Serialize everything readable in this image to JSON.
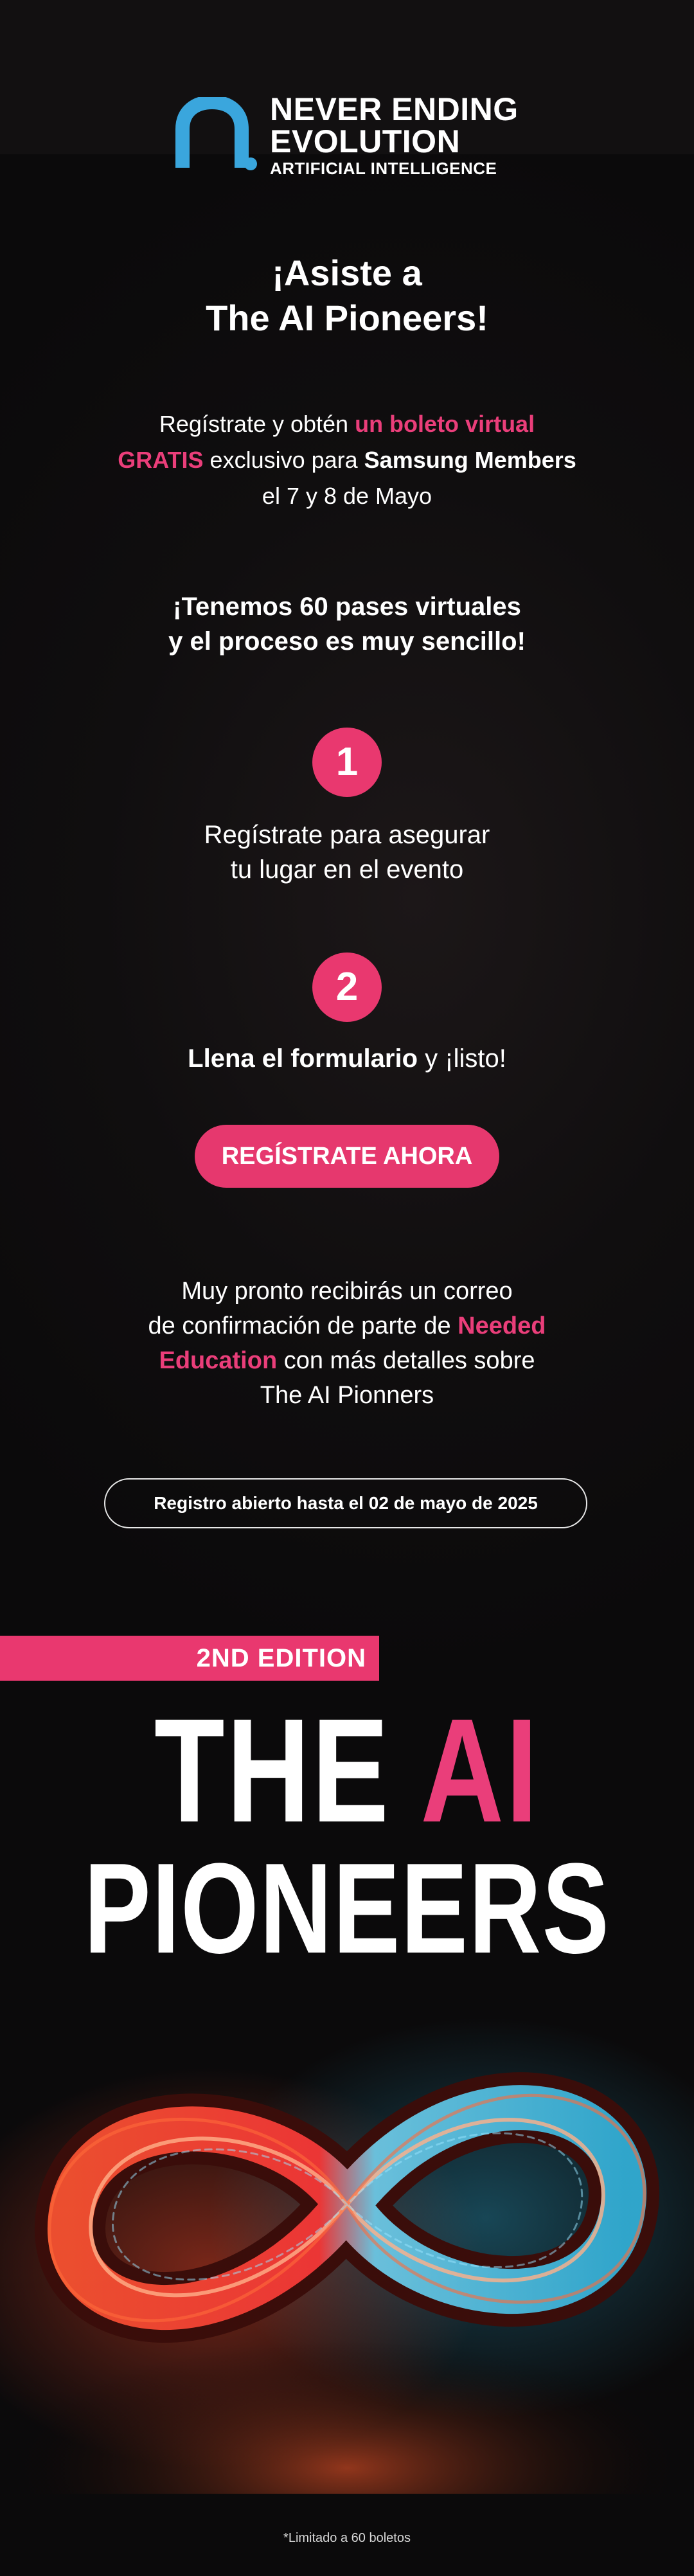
{
  "header": {
    "logo_line1": "NEVER ENDING",
    "logo_line2": "EVOLUTION",
    "logo_line3": "ARTIFICIAL INTELLIGENCE"
  },
  "hero": {
    "title_line1": "¡Asiste a",
    "title_line2": "The AI Pioneers!"
  },
  "intro": {
    "part1": "Regístrate y obtén ",
    "highlight1": "un boleto virtual",
    "highlight2": "GRATIS",
    "part2": " exclusivo para ",
    "bold1": "Samsung Members",
    "line3": "el 7 y 8 de Mayo"
  },
  "passes": {
    "line1": "¡Tenemos 60 pases virtuales",
    "line2": "y el proceso es muy sencillo!"
  },
  "steps": [
    {
      "number": "1",
      "line1": "Regístrate para asegurar",
      "line2": "tu lugar en el evento"
    },
    {
      "number": "2",
      "bold": "Llena el formulario",
      "rest": " y ¡listo!"
    }
  ],
  "cta": {
    "label": "REGÍSTRATE AHORA"
  },
  "confirmation": {
    "line1": "Muy pronto recibirás un correo",
    "line2a": "de confirmación de parte de ",
    "line2b": "Needed",
    "line3a": "Education",
    "line3b": " con más detalles sobre",
    "line4": "The AI Pionners"
  },
  "deadline": {
    "label": "Registro abierto hasta el 02 de mayo de 2025"
  },
  "banner": {
    "edition": "2ND EDITION",
    "title_the": "THE ",
    "title_ai": "AI",
    "title_pioneers": "PIONEERS"
  },
  "footnote": "*Limitado a 60 boletos",
  "colors": {
    "accent_pink": "#e9386f",
    "logo_blue": "#3aa6dd",
    "background": "#0d0b0c"
  }
}
